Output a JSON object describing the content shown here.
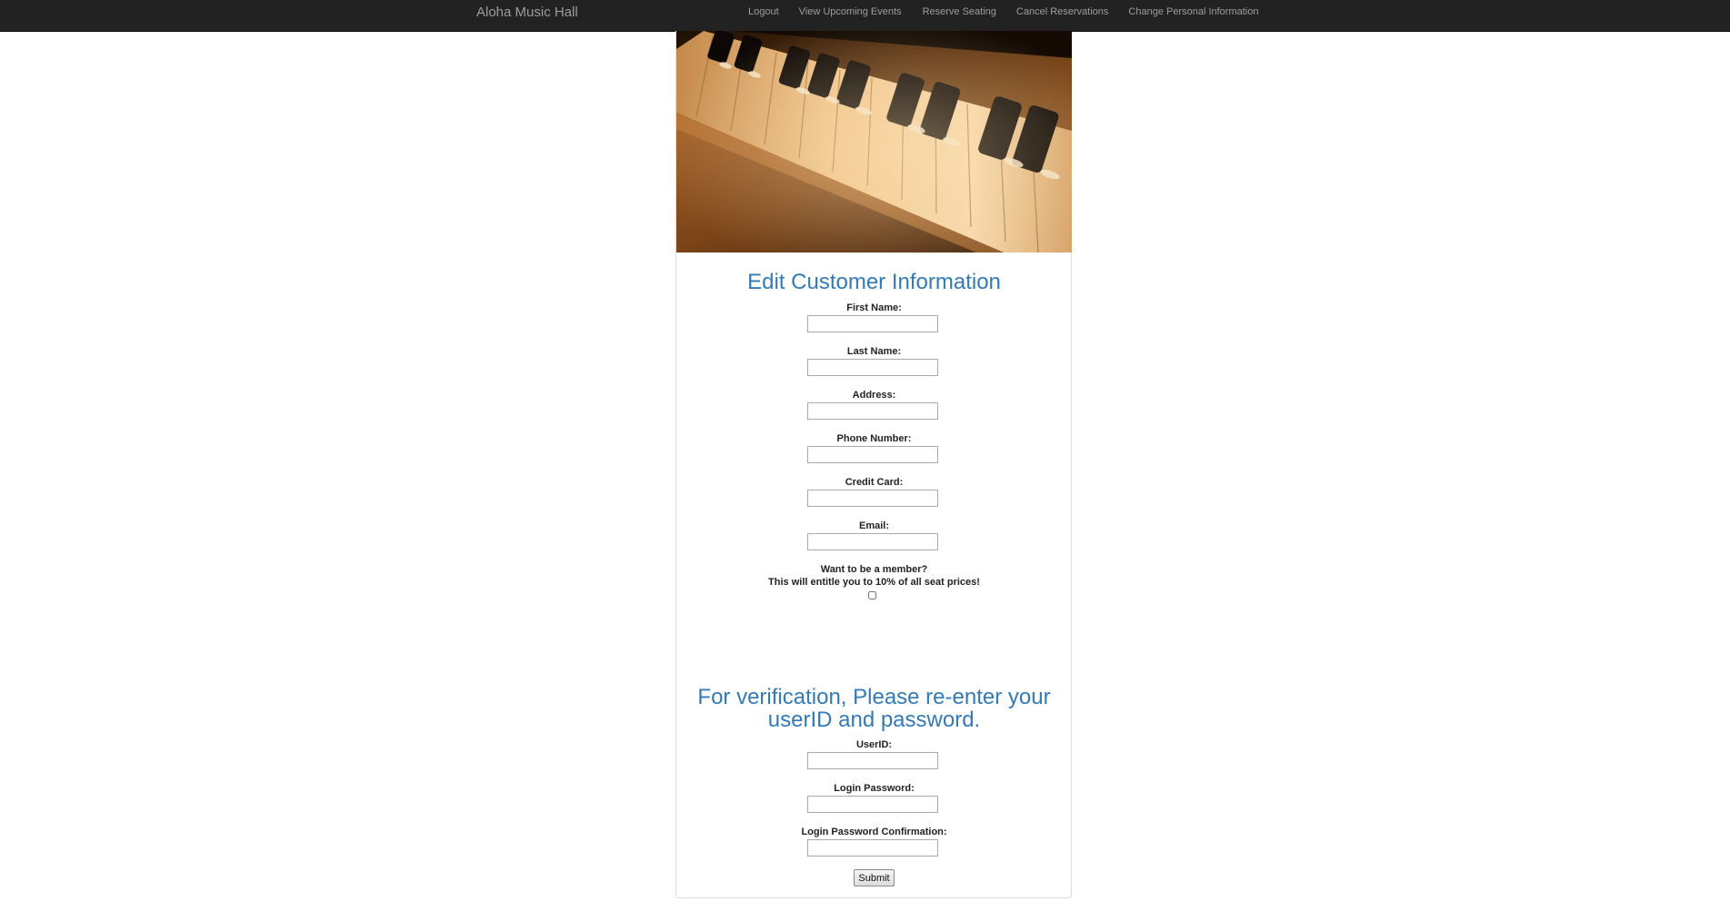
{
  "navbar": {
    "brand": "Aloha Music Hall",
    "links": [
      "Logout",
      "View Upcoming Events",
      "Reserve Seating",
      "Cancel Reservations",
      "Change Personal Information"
    ]
  },
  "hero": {
    "image": "piano-keys-photo"
  },
  "edit_form": {
    "title": "Edit Customer Information",
    "fields": [
      {
        "label": "First Name:",
        "value": ""
      },
      {
        "label": "Last Name:",
        "value": ""
      },
      {
        "label": "Address:",
        "value": ""
      },
      {
        "label": "Phone Number:",
        "value": ""
      },
      {
        "label": "Credit Card:",
        "value": ""
      },
      {
        "label": "Email:",
        "value": ""
      }
    ],
    "membership": {
      "question": "Want to be a member?",
      "benefit": "This will entitle you to 10% of all seat prices!",
      "checked": false
    }
  },
  "verify_form": {
    "title_line1": "For verification, Please re-enter your",
    "title_line2": "userID and password.",
    "fields": [
      {
        "label": "UserID:",
        "value": ""
      },
      {
        "label": "Login Password:",
        "value": ""
      },
      {
        "label": "Login Password Confirmation:",
        "value": ""
      }
    ],
    "submit_label": "Submit"
  }
}
